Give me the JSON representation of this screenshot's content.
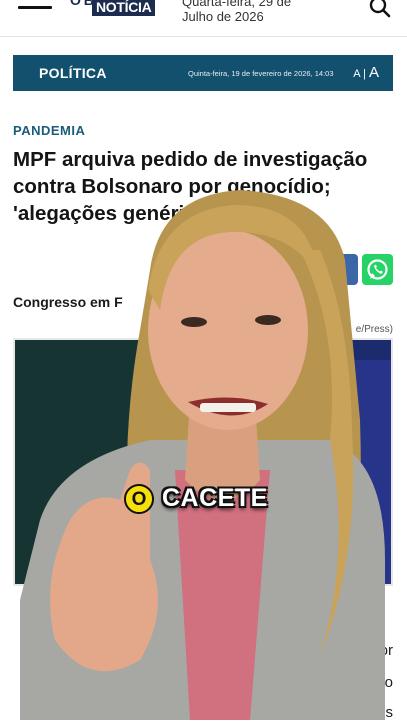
{
  "header": {
    "logo_top": "O BOM DA",
    "logo_bottom": "NOTÍCIA",
    "date": "Quarta-feira, 29 de Julho de 2026"
  },
  "section": {
    "title": "POLÍTICA",
    "date": "Quinta-feira, 19 de fevereiro de 2026, 14:03",
    "font_small": "A",
    "font_large": "A"
  },
  "article": {
    "tag": "PANDEMIA",
    "headline": "MPF arquiva pedido de investigação contra Bolsonaro por genocídio; 'alegações genéri",
    "byline": "Congresso em F",
    "photo_credit": "e/Press)",
    "body_fragments": [
      "u, por",
      "va o",
      "rimes"
    ]
  },
  "caption": {
    "badge": "O",
    "text": "CACETE"
  },
  "colors": {
    "section_bar": "#13506e",
    "tag": "#1a5c7a",
    "whatsapp": "#25d366",
    "caption_badge": "#f6e00c"
  },
  "icons": [
    "menu-icon",
    "search-icon",
    "share-icon",
    "whatsapp-icon"
  ]
}
